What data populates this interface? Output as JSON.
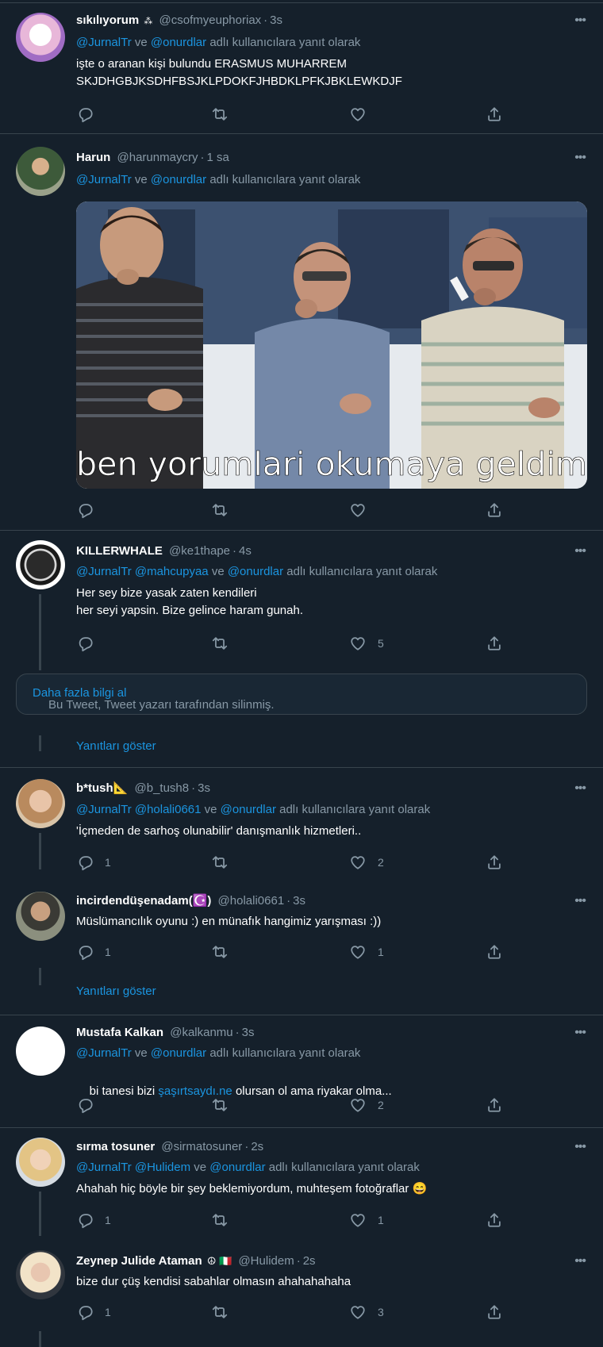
{
  "reply_prefix_and": "ve",
  "reply_suffix": "adlı kullanıcılara yanıt olarak",
  "tweets": [
    {
      "name": "sıkılıyorum",
      "name_badge": "⁂",
      "handle": "@csofmyeuphoriax",
      "time": "3s",
      "mentions": [
        "@JurnalTr",
        "@onurdlar"
      ],
      "text_line1": "işte o aranan kişi bulundu ERASMUS MUHARREM",
      "text_line2": "SKJDHGBJKSDHFBSJKLPDOKFJHBDKLPFKJBKLEWKDJF",
      "reply_count": "",
      "like_count": ""
    },
    {
      "name": "Harun",
      "handle": "@harunmaycry",
      "time": "1 sa",
      "mentions": [
        "@JurnalTr",
        "@onurdlar"
      ],
      "image_caption": "ben yorumlari okumaya geldim",
      "reply_count": "",
      "like_count": ""
    },
    {
      "name": "KILLERWHALE",
      "handle": "@ke1thape",
      "time": "4s",
      "mentions": [
        "@JurnalTr @mahcupyaa",
        "@onurdlar"
      ],
      "text_line1": "Her sey bize yasak zaten kendileri",
      "text_line2": "her seyi yapsin. Bize gelince haram gunah.",
      "reply_count": "",
      "like_count": "5"
    },
    {
      "name": "b*tush📐",
      "handle": "@b_tush8",
      "time": "3s",
      "mentions": [
        "@JurnalTr @holali0661",
        "@onurdlar"
      ],
      "text_line1": "'İçmeden de sarhoş olunabilir' danışmanlık hizmetleri..",
      "reply_count": "1",
      "like_count": "2"
    },
    {
      "name": "incirdendüşenadam(☪️)",
      "handle": "@holali0661",
      "time": "3s",
      "text_line1": "Müslümancılık oyunu :) en münafık hangimiz yarışması :))",
      "reply_count": "1",
      "like_count": "1"
    },
    {
      "name": "Mustafa Kalkan",
      "handle": "@kalkanmu",
      "time": "3s",
      "mentions": [
        "@JurnalTr",
        "@onurdlar"
      ],
      "text_before": "bi tanesi bizi ",
      "text_link": "şaşırtsaydı.ne",
      "text_after": " olursan ol ama riyakar olma...",
      "reply_count": "",
      "like_count": "2"
    },
    {
      "name": "sırma tosuner",
      "handle": "@sirmatosuner",
      "time": "2s",
      "mentions": [
        "@JurnalTr @Hulidem",
        "@onurdlar"
      ],
      "text_line1": "Ahahah hiç böyle bir şey beklemiyordum, muhteşem fotoğraflar 😄",
      "reply_count": "1",
      "like_count": "1"
    },
    {
      "name": "Zeynep Julide Ataman",
      "name_badge": "☮ 🇮🇹",
      "handle": "@Hulidem",
      "time": "2s",
      "text_line1": "bize dur çüş kendisi sabahlar olmasın ahahahahaha",
      "reply_count": "1",
      "like_count": "3"
    }
  ],
  "deleted_notice": "Bu Tweet, Tweet yazarı tarafından silinmiş.",
  "deleted_more": "Daha fazla bilgi al",
  "show_replies": "Yanıtları göster",
  "more_glyph": "•••",
  "separator_dot": "·",
  "colors": {
    "background": "#15202b",
    "border": "#38444d",
    "secondary_text": "#8899a6",
    "link": "#1b95e0"
  },
  "icons": [
    "reply-icon",
    "retweet-icon",
    "like-icon",
    "share-icon",
    "more-icon"
  ]
}
